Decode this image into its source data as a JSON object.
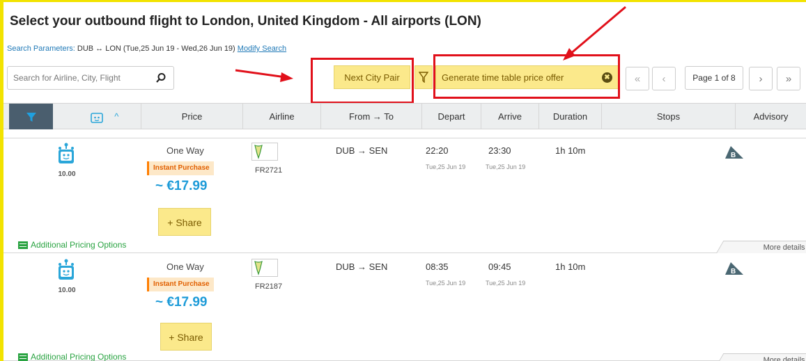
{
  "page": {
    "title": "Select your outbound flight to London, United Kingdom - All airports (LON)",
    "search_params_label": "Search Parameters:",
    "search_params_value": "DUB ↔ LON (Tue,25 Jun 19 - Wed,26 Jun 19)",
    "modify_search": "Modify Search"
  },
  "toolbar": {
    "search_placeholder": "Search for Airline, City, Flight",
    "next_city_pair": "Next City Pair",
    "generate_offer": "Generate time table price offer",
    "close_glyph": "✖",
    "pager_first": "«",
    "pager_prev": "‹",
    "page_label": "Page 1 of 8",
    "pager_next": "›",
    "pager_last": "»"
  },
  "table_header": {
    "sort_caret": "^",
    "price": "Price",
    "airline": "Airline",
    "from_to": "From → To",
    "depart": "Depart",
    "arrive": "Arrive",
    "duration": "Duration",
    "stops": "Stops",
    "advisory": "Advisory"
  },
  "flights": [
    {
      "score": "10.00",
      "fare_type": "One Way",
      "badge": "Instant Purchase",
      "price": "~ €17.99",
      "share": "+ Share",
      "flight_no": "FR2721",
      "route": "DUB → SEN",
      "depart_time": "22:20",
      "depart_date": "Tue,25 Jun 19",
      "arrive_time": "23:30",
      "arrive_date": "Tue,25 Jun 19",
      "duration": "1h 10m",
      "additional": "Additional Pricing Options",
      "more_details": "More details"
    },
    {
      "score": "10.00",
      "fare_type": "One Way",
      "badge": "Instant Purchase",
      "price": "~ €17.99",
      "share": "+ Share",
      "flight_no": "FR2187",
      "route": "DUB → SEN",
      "depart_time": "08:35",
      "depart_date": "Tue,25 Jun 19",
      "arrive_time": "09:45",
      "arrive_date": "Tue,25 Jun 19",
      "duration": "1h 10m",
      "additional": "Additional Pricing Options",
      "more_details": "More details"
    }
  ],
  "colors": {
    "highlight_yellow": "#fbe98b",
    "annotation_red": "#e1101a",
    "price_blue": "#1d9bd8",
    "badge_orange": "#ff7d00",
    "link_green": "#29a341"
  }
}
